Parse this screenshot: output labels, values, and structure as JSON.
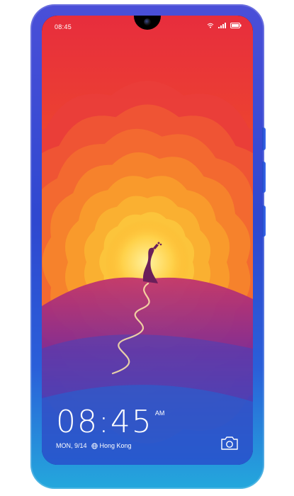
{
  "status_bar": {
    "time": "08:45",
    "icons": [
      "wifi-icon",
      "signal-icon",
      "battery-icon"
    ]
  },
  "lock_screen": {
    "time": "08:45",
    "ampm": "AM",
    "date": "MON, 9/14",
    "location": "Hong Kong"
  },
  "colors": {
    "phone_frame_top": "#4a4fd8",
    "phone_frame_bottom": "#24a8dc",
    "sun_center": "#ffe27a",
    "sky_orange": "#f26a2a",
    "sky_red": "#e8323a",
    "ground_purple": "#8a2a8e",
    "ground_blue": "#2a4ec8"
  }
}
